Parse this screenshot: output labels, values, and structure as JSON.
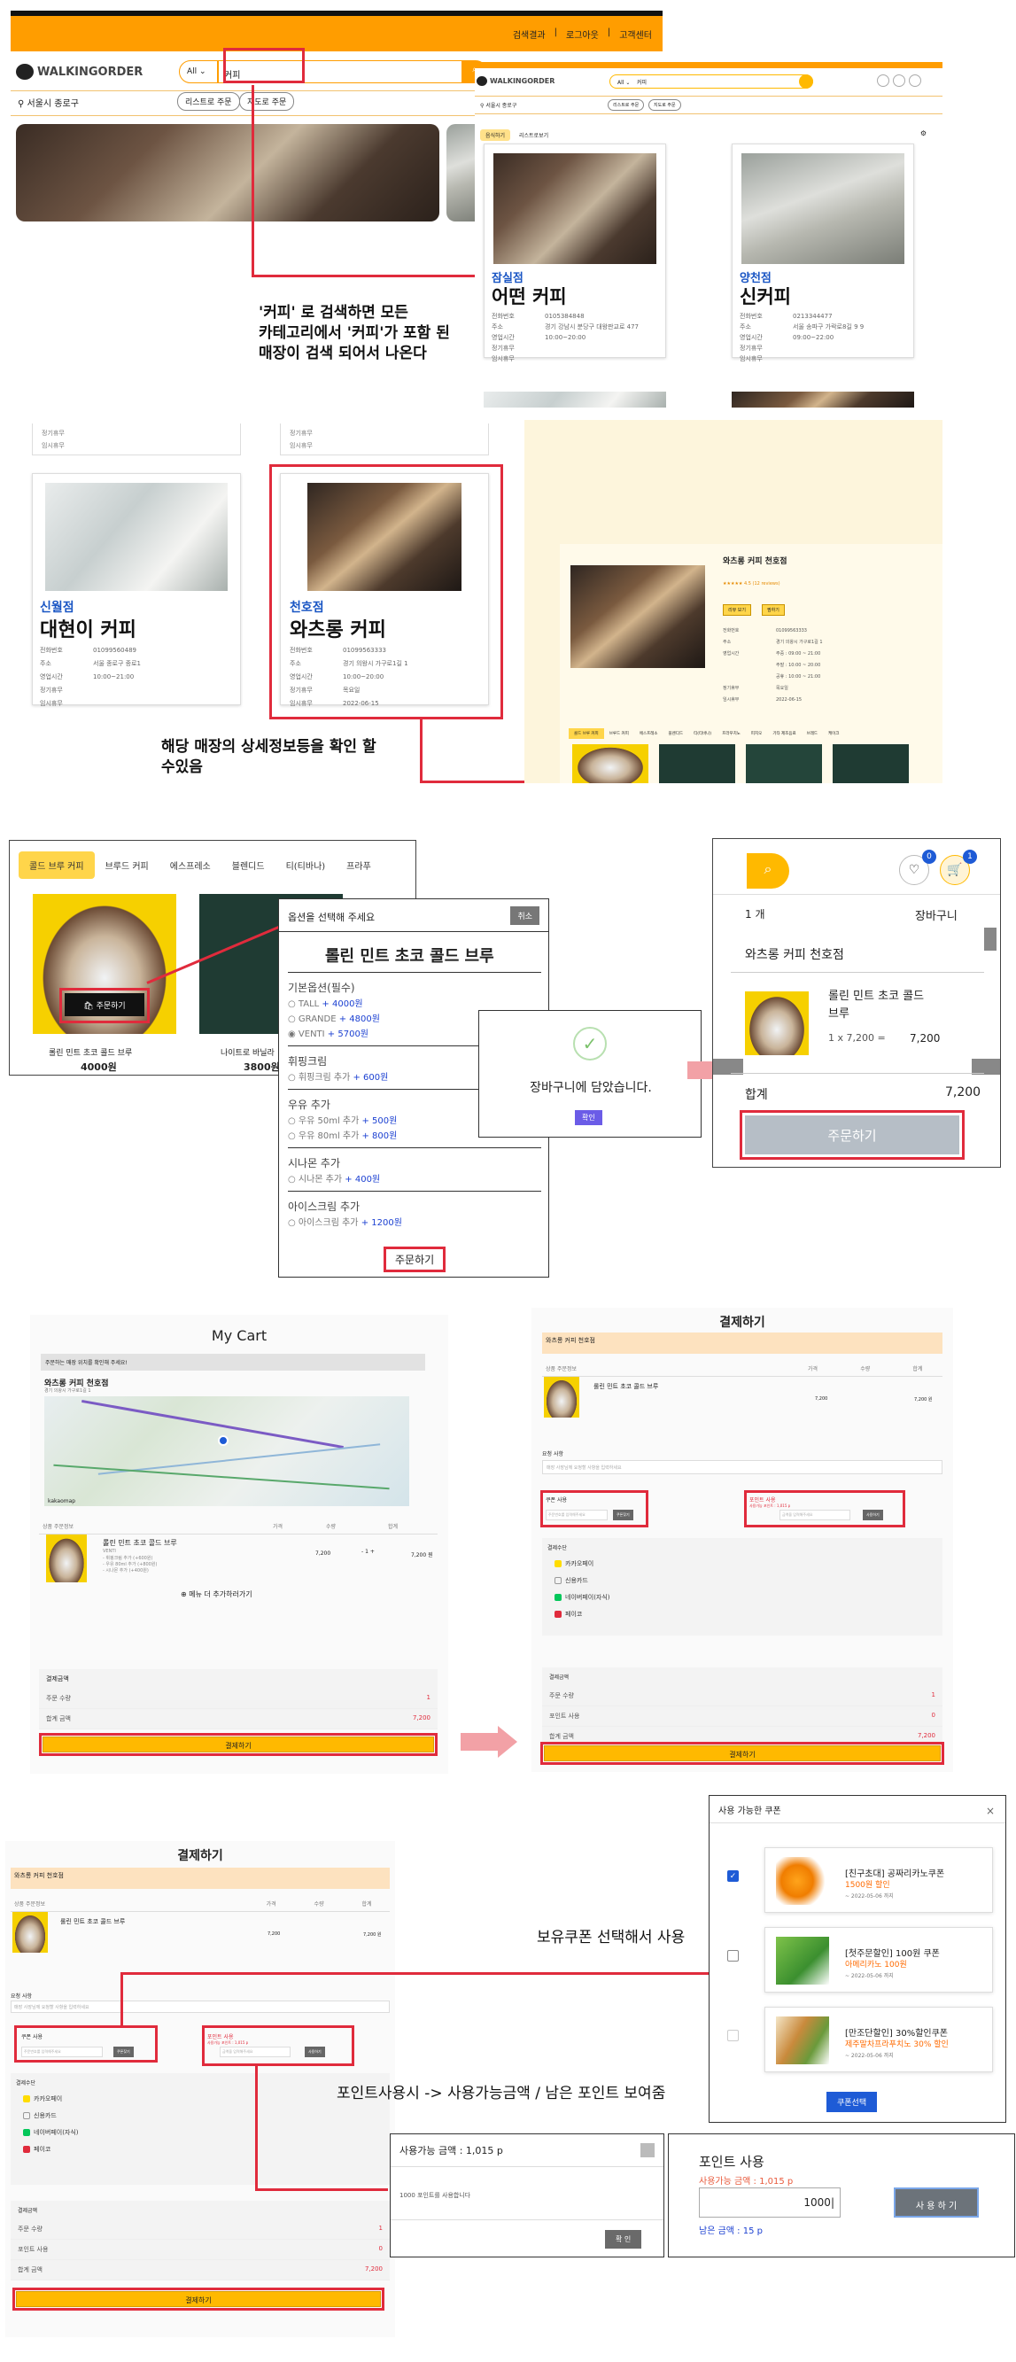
{
  "s1": {
    "top_links": [
      "검색결과",
      "로그아웃",
      "고객센터"
    ],
    "logo_text": "WALKINGORDER",
    "search_scope": "All",
    "search_value": "커피",
    "location": "서울시 종로구",
    "pill_list": "리스트로 주문",
    "pill_map": "지도로 주문",
    "note": "'커피' 로 검색하면 모든\n카테고리에서 '커피'가 포함 된\n매장이 검색 되어서 나온다",
    "cart_badge": "0",
    "notif_badge": "1",
    "result_tabs": [
      "음식하기",
      "리스트로보기"
    ],
    "cards": [
      {
        "branch": "잠실점",
        "name": "어떤 커피",
        "rows": [
          [
            "전화번호",
            "0105384848"
          ],
          [
            "주소",
            "경기 강남시 분당구 대왕판교로 477"
          ],
          [
            "영업시간",
            "10:00~20:00"
          ],
          [
            "정기휴무",
            ""
          ],
          [
            "임시휴무",
            ""
          ]
        ]
      },
      {
        "branch": "양천점",
        "name": "신커피",
        "rows": [
          [
            "전화번호",
            "0213344477"
          ],
          [
            "주소",
            "서울 송파구 가락로8길 9 9"
          ],
          [
            "영업시간",
            "09:00~22:00"
          ],
          [
            "정기휴무",
            ""
          ],
          [
            "임시휴무",
            ""
          ]
        ]
      }
    ]
  },
  "s2": {
    "stub_rows": [
      "정기휴무",
      "임시휴무"
    ],
    "cards": [
      {
        "branch": "신월점",
        "name": "대현이 커피",
        "rows": [
          [
            "전화번호",
            "01099560489"
          ],
          [
            "주소",
            "서울 종로구 종로1"
          ],
          [
            "영업시간",
            "10:00~21:00"
          ],
          [
            "정기휴무",
            ""
          ],
          [
            "임시휴무",
            ""
          ]
        ]
      },
      {
        "branch": "천호점",
        "name": "와츠롱 커피",
        "rows": [
          [
            "전화번호",
            "01099563333"
          ],
          [
            "주소",
            "경기 의왕시 가구로1길 1"
          ],
          [
            "영업시간",
            "10:00~20:00"
          ],
          [
            "정기휴무",
            "목요일"
          ],
          [
            "임시휴무",
            "2022-06-15"
          ]
        ]
      }
    ],
    "detail": {
      "title": "와츠롱 커피 천호점",
      "rating": "★★★★★ 4.5 (12 reviews)",
      "btn_a": "리뷰 보기",
      "btn_b": "찜하기",
      "rows": [
        [
          "전화번호",
          "01099563333"
        ],
        [
          "주소",
          "경기 의왕시 가구로1길 1"
        ],
        [
          "영업시간",
          "주중 : 09:00 ~ 21:00"
        ],
        [
          "",
          "주말 : 10:00 ~ 20:00"
        ],
        [
          "",
          "공휴 : 10:00 ~ 21:00"
        ],
        [
          "정기휴무",
          "목요일"
        ],
        [
          "임시휴무",
          "2022-06-15"
        ]
      ],
      "tabs": [
        "콜드 브루 커피",
        "브루드 커피",
        "에스프레소",
        "블렌디드",
        "티(티바나)",
        "프라푸치노",
        "피지오",
        "기타 제조음료",
        "브레드",
        "케이크"
      ]
    },
    "note": "해당 매장의 상세정보등을 확인 할\n수있음"
  },
  "s3": {
    "tabs": [
      "콜드 브루 커피",
      "브루드 커피",
      "에스프레소",
      "블렌디드",
      "티(티바나)",
      "프라푸"
    ],
    "order_btn": "주문하기",
    "item1_name": "롤린 민트 초코 콜드 브루",
    "item1_price": "4000원",
    "item2_name": "나이트로 바닐라",
    "item2_price": "3800원",
    "modal": {
      "header": "옵션을 선택해 주세요",
      "close": "취소",
      "title": "롤린 민트 초코 콜드 브루",
      "sections": [
        {
          "title": "기본옵션(필수)",
          "opts": [
            [
              "TALL",
              "+ 4000원"
            ],
            [
              "GRANDE",
              "+ 4800원"
            ],
            [
              "VENTI",
              "+ 5700원"
            ]
          ]
        },
        {
          "title": "휘핑크림",
          "opts": [
            [
              "휘핑크림 추가",
              "+ 600원"
            ]
          ]
        },
        {
          "title": "우유 추가",
          "opts": [
            [
              "우유 50ml 추가",
              "+ 500원"
            ],
            [
              "우유 80ml 추가",
              "+ 800원"
            ]
          ]
        },
        {
          "title": "시나몬 추가",
          "opts": [
            [
              "시나몬 추가",
              "+ 400원"
            ]
          ]
        },
        {
          "title": "아이스크림 추가",
          "opts": [
            [
              "아이스크림 추가",
              "+ 1200원"
            ]
          ]
        }
      ],
      "submit": "주문하기"
    },
    "alert": {
      "text": "장바구니에 담았습니다.",
      "ok": "확인"
    },
    "cart": {
      "heart_badge": "0",
      "cart_badge": "1",
      "count": "1 개",
      "title": "장바구니",
      "store": "와츠롱 커피 천호점",
      "item": "롤린 민트 초코 콜드\n브루",
      "qty_price": "1 x 7,200 =",
      "item_total": "7,200",
      "total_label": "합계",
      "total": "7,200",
      "order": "주문하기"
    }
  },
  "s4": {
    "cart_title": "My Cart",
    "notice": "주문하는 매장 위치를 확인해 주세요!",
    "store": "와츠롱 커피 천호점",
    "store_addr": "경기 의왕시 가구로1길 1",
    "map_brand": "kakaomap",
    "th": [
      "상품 주문정보",
      "가격",
      "수량",
      "합계"
    ],
    "item": "롤린 민트 초코 콜드 브루",
    "item_size": "VENTI",
    "item_opts": [
      "- 휘핑크림 추가 (+600원)",
      "- 우유 80ml 추가 (+800원)",
      "- 시나몬 추가 (+400원)"
    ],
    "price": "7,200",
    "qty": "1",
    "sum": "7,200 원",
    "more": "⊕ 메뉴 더 추가하러가기",
    "summary_title": "결제금액",
    "summary": [
      [
        "주문 수량",
        "1"
      ],
      [
        "합계 금액",
        "7,200"
      ]
    ],
    "pay_btn": "결제하기",
    "pay_title": "결제하기",
    "pay_store": "와츠롱 커피 천호점",
    "req_label": "요청 사항",
    "req_placeholder": "매장 사장님께 요청할 사항을 입력하세요",
    "coupon_label": "쿠폰 사용",
    "coupon_placeholder": "주문번호를 입력해주세요",
    "coupon_btn": "쿠폰찾기",
    "point_label": "포인트 사용",
    "point_sub": "사용가능 포인트 : 1,015 p",
    "point_placeholder": "금액을 입력해주세요",
    "point_btn": "사용하기",
    "method_label": "결제수단",
    "methods": [
      "카카오페이",
      "신용카드",
      "네이버페이(자식)",
      "페이코"
    ],
    "pay_summary": [
      [
        "주문 수량",
        "1"
      ],
      [
        "포인트 사용",
        "0"
      ],
      [
        "합계 금액",
        "7,200"
      ]
    ]
  },
  "s5": {
    "pay_title": "결제하기",
    "note_coupon": "보유쿠폰 선택해서 사용",
    "note_point": "포인트사용시 -> 사용가능금액 / 남은 포인트 보여줌",
    "pay_summary": [
      [
        "주문 수량",
        "1"
      ],
      [
        "포인트 사용",
        "0"
      ],
      [
        "합계 금액",
        "7,200"
      ]
    ],
    "coupon_modal": {
      "title": "사용 가능한 쿠폰",
      "close": "×",
      "items": [
        {
          "title": "[친구초대] 공짜리카노쿠폰",
          "discount": "1500원 할인",
          "expire": "~ 2022-05-06 까지"
        },
        {
          "title": "[첫주문할인] 100원 쿠폰",
          "discount": "아메리카노 100원",
          "expire": "~ 2022-05-06 까지"
        },
        {
          "title": "[만조단할인] 30%할인쿠폰",
          "discount": "제주말차프라푸치노 30% 할인",
          "expire": "~ 2022-05-06 까지"
        }
      ],
      "select": "쿠폰선택"
    },
    "point_modal": {
      "title": "사용가능 금액 : 1,015 p",
      "msg": "1000 포인트를 사용합니다",
      "ok": "확 인"
    },
    "point_box": {
      "title": "포인트 사용",
      "available": "사용가능 금액 : 1,015 p",
      "value": "1000",
      "btn": "사 용 하 기",
      "remain": "남은 금액 : 15 p"
    }
  },
  "colors": {
    "accent": "#ff9d00",
    "highlight": "#e02b3c",
    "link_blue": "#1a3fd1",
    "badge_blue": "#1e5bd6"
  }
}
